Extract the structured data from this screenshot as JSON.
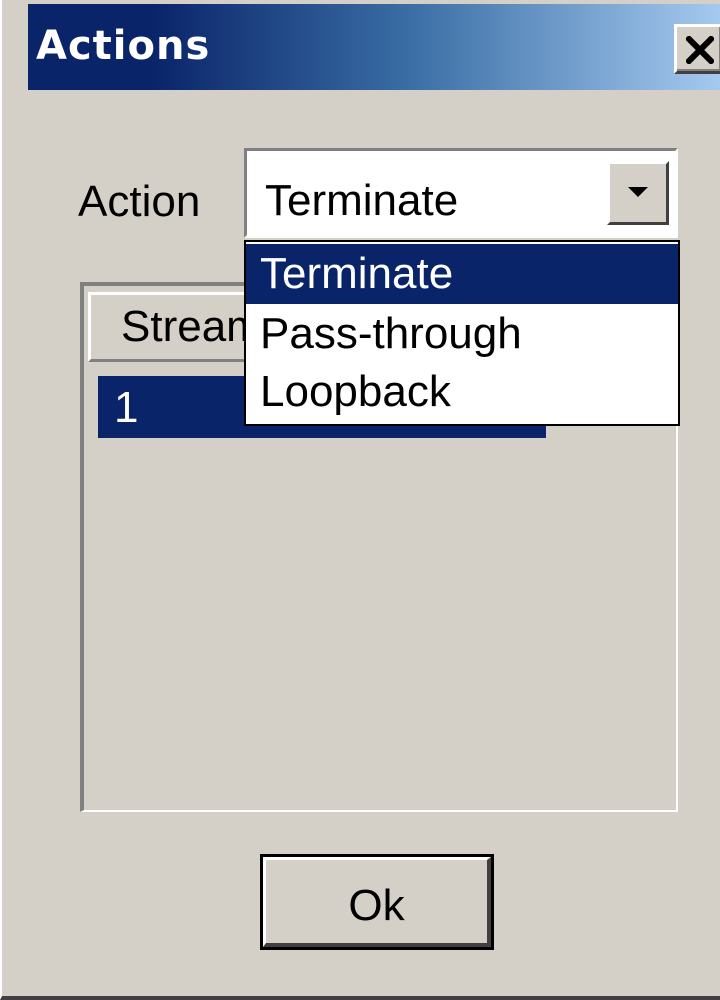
{
  "window": {
    "title": "Actions",
    "close_icon": "close-x-icon"
  },
  "action_field": {
    "label": "Action",
    "selected_value": "Terminate",
    "dropdown_icon": "chevron-down-icon",
    "options": [
      "Terminate",
      "Pass-through",
      "Loopback"
    ],
    "highlighted_option": "Terminate"
  },
  "stream_list": {
    "column_header": "Stream",
    "rows": [
      "1"
    ]
  },
  "buttons": {
    "ok_label": "Ok"
  },
  "colors": {
    "title_bar_start": "#0a246a",
    "title_bar_end": "#a6caf0",
    "selection": "#0a246a",
    "window_face": "#d4d0c8"
  }
}
